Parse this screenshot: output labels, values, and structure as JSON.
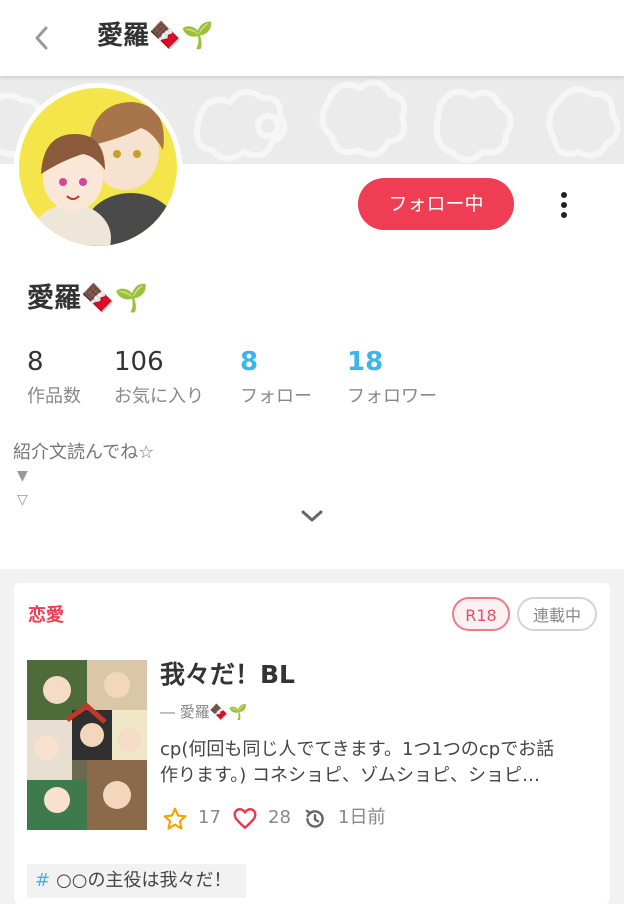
{
  "header": {
    "title": "愛羅🍫🌱",
    "back_icon": "chevron-left-icon"
  },
  "profile": {
    "name": "愛羅🍫🌱",
    "follow_button": "フォロー中",
    "stats": [
      {
        "value": "8",
        "label": "作品数"
      },
      {
        "value": "106",
        "label": "お気に入り"
      },
      {
        "value": "8",
        "label": "フォロー"
      },
      {
        "value": "18",
        "label": "フォロワー"
      }
    ],
    "bio": {
      "text": "紹介文読んでね☆",
      "arrow1": "▼",
      "arrow2": "▽"
    },
    "colors": {
      "follow": "#ef3d54",
      "link": "#3cb6e8"
    }
  },
  "work": {
    "genre": "恋愛",
    "badges": {
      "r18": "R18",
      "serial": "連載中"
    },
    "title": "我々だ！BL",
    "author": "― 愛羅🍫🌱",
    "description_lines": [
      "cp(何回も同じ人でてきます。1つ1つのcpでお話",
      "作ります。) コネショピ、ゾムショピ、ショピ…"
    ],
    "stars": "17",
    "likes": "28",
    "updated": "1日前",
    "tag": {
      "hash": "#",
      "label": "○○の主役は我々だ！"
    }
  }
}
